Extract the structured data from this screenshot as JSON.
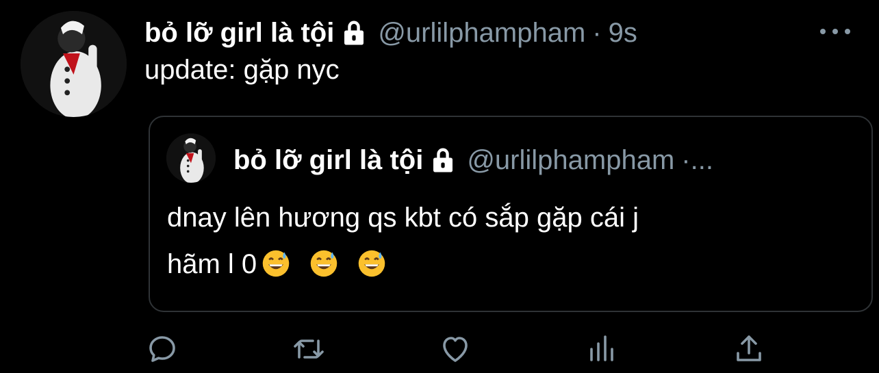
{
  "tweet": {
    "display_name": "bỏ lỡ girl là tội",
    "handle": "@urlilphampham",
    "separator": "·",
    "time": "9s",
    "text": "update: gặp nyc"
  },
  "quoted_tweet": {
    "display_name": "bỏ lỡ girl là tội",
    "handle": "@urlilphampham",
    "truncation": "·...",
    "text_line1": "dnay lên hương qs kbt có sắp gặp cái j",
    "text_line2": "hãm l 0"
  },
  "icons": {
    "lock": "lock-icon",
    "more": "more-options-icon",
    "emoji": "grinning-face-with-sweat-emoji",
    "reply": "reply-icon",
    "retweet": "retweet-icon",
    "like": "heart-icon",
    "analytics": "analytics-icon",
    "share": "share-icon"
  },
  "colors": {
    "background": "#000000",
    "text": "#ffffff",
    "secondary": "#8899a6",
    "border": "#2f3336"
  }
}
